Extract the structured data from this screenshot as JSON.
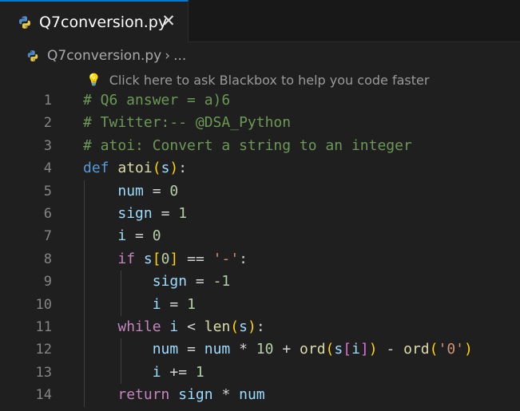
{
  "tab": {
    "title": "Q7conversion.py",
    "close_glyph": "✕"
  },
  "breadcrumb": {
    "file": "Q7conversion.py",
    "separator": "›",
    "more": "..."
  },
  "hint": {
    "text": "Click here to ask Blackbox to help you code faster"
  },
  "colors": {
    "comment": "#6a9955",
    "keyword": "#569cd6",
    "control": "#c586c0",
    "function": "#dcdcaa",
    "variable": "#9cdcfe",
    "number": "#b5cea8",
    "string": "#ce9178",
    "active_tab_border": "#0078d4"
  },
  "editor": {
    "line_numbers": [
      "1",
      "2",
      "3",
      "4",
      "5",
      "6",
      "7",
      "8",
      "9",
      "10",
      "11",
      "12",
      "13",
      "14"
    ],
    "tokens": {
      "l1_comment": "# Q6 answer = a)6",
      "l2_comment": "# Twitter:-- @DSA_Python",
      "l3_comment": "# atoi: Convert a string to an integer",
      "def": "def",
      "atoi": "atoi",
      "s": "s",
      "num": "num",
      "sign": "sign",
      "i": "i",
      "zero": "0",
      "one": "1",
      "neg_one": "-1",
      "ten": "10",
      "if": "if",
      "while": "while",
      "return": "return",
      "len": "len",
      "ord": "ord",
      "dash_str": "'-'",
      "zero_str": "'0'"
    }
  }
}
